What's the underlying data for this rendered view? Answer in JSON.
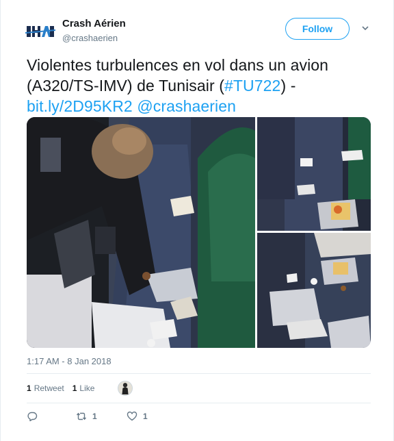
{
  "user": {
    "display_name": "Crash Aérien",
    "screen_name": "@crashaerien",
    "avatar_text": "CRASH AÉRIEN"
  },
  "follow_label": "Follow",
  "tweet": {
    "text_line1": "Violentes turbulences en vol dans un avion",
    "text_line2_a": "(A320/TS-IMV) de Tunisair (",
    "hashtag": "#TU722",
    "text_line2_b": ") -",
    "link": "bit.ly/2D95KR2",
    "mention": "@crashaerien"
  },
  "timestamp": "1:17 AM - 8 Jan 2018",
  "stats": {
    "retweets_count": "1",
    "retweets_label": "Retweet",
    "likes_count": "1",
    "likes_label": "Like"
  },
  "actions": {
    "reply_icon": "reply-icon",
    "retweet_icon": "retweet-icon",
    "retweet_count": "1",
    "like_icon": "heart-icon",
    "like_count": "1"
  },
  "colors": {
    "accent": "#1da1f2",
    "text": "#14171a",
    "muted": "#657786"
  }
}
